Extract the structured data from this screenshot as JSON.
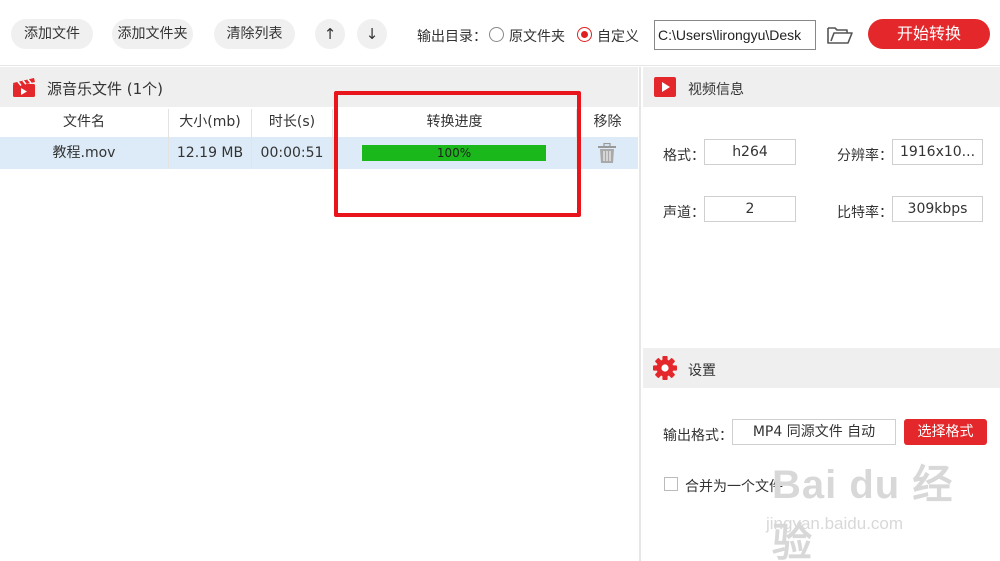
{
  "toolbar": {
    "add_file": "添加文件",
    "add_folder": "添加文件夹",
    "clear_list": "清除列表",
    "move_up": "↑",
    "move_down": "↓",
    "output_dir_label": "输出目录：",
    "radio_original": "原文件夹",
    "radio_custom": "自定义",
    "selected_output": "自定义",
    "path_value": "C:\\Users\\lirongyu\\Desk",
    "start_convert": "开始转换"
  },
  "file_list": {
    "title": "源音乐文件 (1个)",
    "columns": [
      "文件名",
      "大小(mb)",
      "时长(s)",
      "转换进度",
      "移除"
    ],
    "rows": [
      {
        "name": "教程.mov",
        "size": "12.19 MB",
        "duration": "00:00:51",
        "progress_text": "100%",
        "progress": 1.0
      }
    ]
  },
  "video_info": {
    "title": "视频信息",
    "format_label": "格式：",
    "format_value": "h264",
    "resolution_label": "分辨率：",
    "resolution_value": "1916x10...",
    "channels_label": "声道：",
    "channels_value": "2",
    "bitrate_label": "比特率：",
    "bitrate_value": "309kbps"
  },
  "settings": {
    "title": "设置",
    "output_format_label": "输出格式：",
    "output_format_value": "MP4 同源文件 自动",
    "select_format": "选择格式",
    "merge_label": "合并为一个文件",
    "merge_checked": false
  },
  "watermark": {
    "logo": "Bai du 经验",
    "url": "jingyan.baidu.com"
  },
  "colors": {
    "accent_red": "#e4272a",
    "progress_green": "#1bb81b",
    "row_selected": "#dcebf7",
    "highlight_box": "#e8151c"
  },
  "icons": [
    "arrow-up-icon",
    "arrow-down-icon",
    "folder-open-icon",
    "clapperboard-icon",
    "trash-icon",
    "play-icon",
    "gear-icon"
  ]
}
